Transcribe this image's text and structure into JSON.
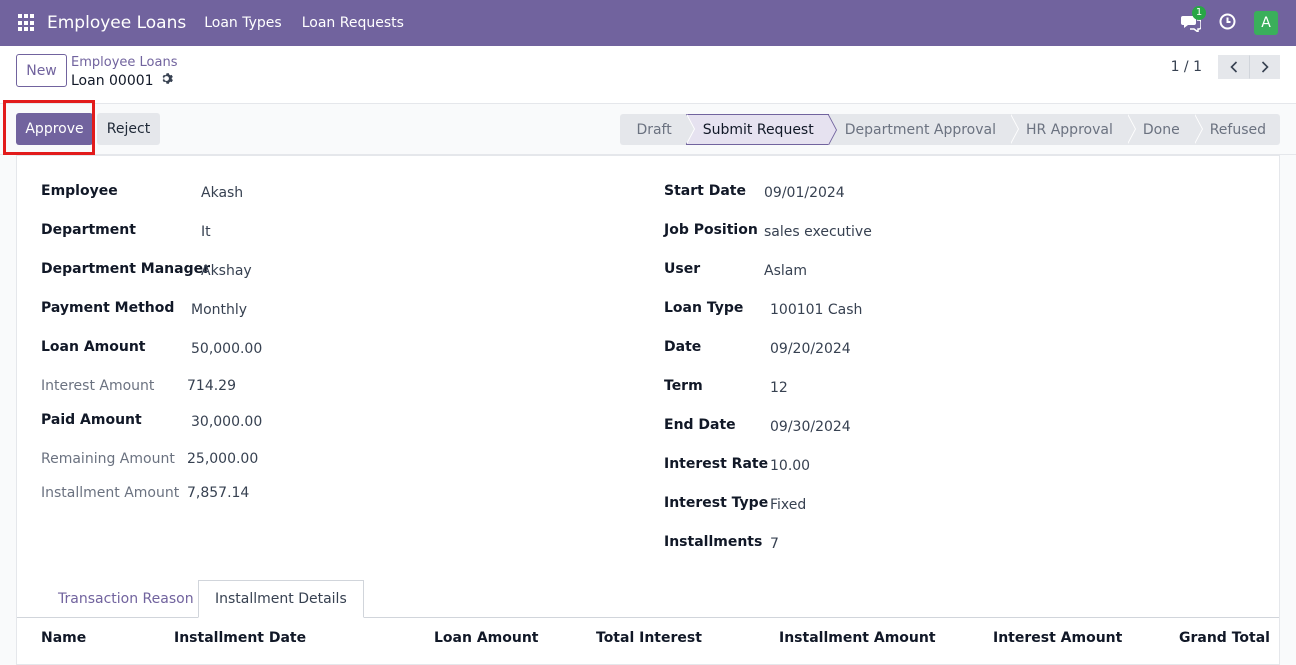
{
  "navbar": {
    "brand": "Employee Loans",
    "links": [
      "Loan Types",
      "Loan Requests"
    ],
    "message_count": "1",
    "avatar_letter": "A"
  },
  "breadcrumb": {
    "new_label": "New",
    "parent": "Employee Loans",
    "current": "Loan 00001"
  },
  "pager": {
    "value": "1 / 1"
  },
  "actions": {
    "approve": "Approve",
    "reject": "Reject"
  },
  "stages": [
    "Draft",
    "Submit Request",
    "Department Approval",
    "HR Approval",
    "Done",
    "Refused"
  ],
  "active_stage": "Submit Request",
  "left_fields": [
    {
      "label": "Employee",
      "value": "Akash"
    },
    {
      "label": "Department",
      "value": "It"
    },
    {
      "label": "Department Manager",
      "value": "Akshay"
    },
    {
      "label": "Payment Method",
      "value": "Monthly"
    },
    {
      "label": "Loan Amount",
      "value": "50,000.00"
    },
    {
      "label": "Interest Amount",
      "value": "714.29"
    },
    {
      "label": "Paid Amount",
      "value": "30,000.00"
    },
    {
      "label": "Remaining Amount",
      "value": "25,000.00"
    },
    {
      "label": "Installment Amount",
      "value": "7,857.14"
    }
  ],
  "right_fields": [
    {
      "label": "Start Date",
      "value": "09/01/2024"
    },
    {
      "label": "Job Position",
      "value": "sales executive"
    },
    {
      "label": "User",
      "value": "Aslam"
    },
    {
      "label": "Loan Type",
      "value": "100101 Cash"
    },
    {
      "label": "Date",
      "value": "09/20/2024"
    },
    {
      "label": "Term",
      "value": "12"
    },
    {
      "label": "End Date",
      "value": "09/30/2024"
    },
    {
      "label": "Interest Rate",
      "value": "10.00"
    },
    {
      "label": "Interest Type",
      "value": "Fixed"
    },
    {
      "label": "Installments",
      "value": "7"
    }
  ],
  "tabs": [
    "Transaction Reason",
    "Installment Details"
  ],
  "table_headers": [
    "Name",
    "Installment Date",
    "Loan Amount",
    "Total Interest",
    "Installment Amount",
    "Interest Amount",
    "Grand Total"
  ],
  "colors": {
    "brand": "#71639e",
    "highlight": "#e21b1b",
    "badge": "#28a745",
    "avatar": "#3aaf5b"
  }
}
